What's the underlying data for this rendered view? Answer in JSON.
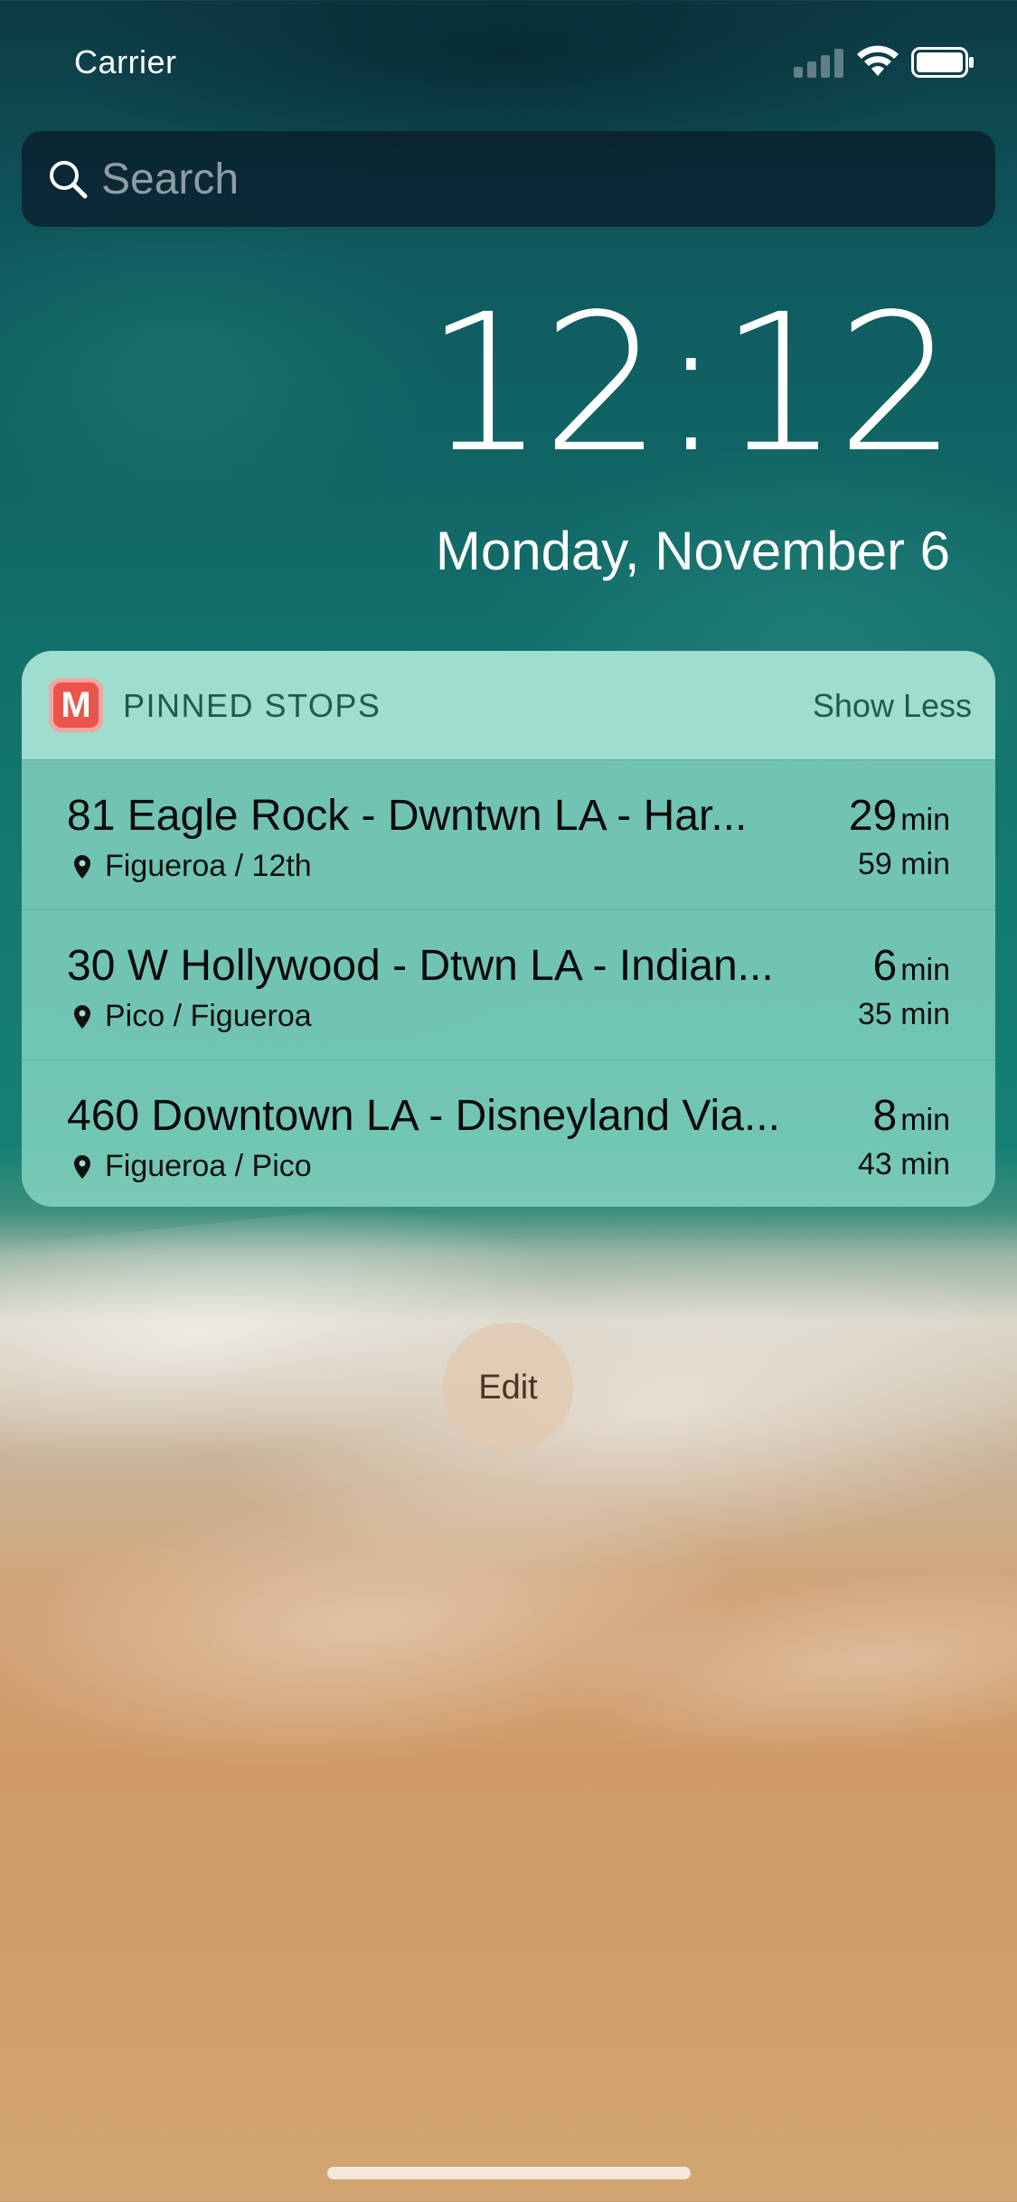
{
  "status_bar": {
    "carrier": "Carrier",
    "signal_icon": "cellular-signal-icon",
    "wifi_icon": "wifi-icon",
    "battery_icon": "battery-icon"
  },
  "search": {
    "placeholder": "Search",
    "icon": "search-icon"
  },
  "lock_screen": {
    "time": "12:12",
    "date": "Monday, November 6"
  },
  "widget": {
    "app_icon_letter": "M",
    "app_icon_color": "#e9554c",
    "title": "PINNED STOPS",
    "toggle_label": "Show Less",
    "rows": [
      {
        "route": "81 Eagle Rock - Dwntwn LA - Har...",
        "stop": "Figueroa / 12th",
        "eta_primary": "29",
        "eta_primary_unit": "min",
        "eta_secondary": "59 min"
      },
      {
        "route": "30 W Hollywood - Dtwn LA - Indian...",
        "stop": "Pico / Figueroa",
        "eta_primary": "6",
        "eta_primary_unit": "min",
        "eta_secondary": "35 min"
      },
      {
        "route": "460 Downtown LA - Disneyland Via...",
        "stop": "Figueroa / Pico",
        "eta_primary": "8",
        "eta_primary_unit": "min",
        "eta_secondary": "43 min"
      }
    ]
  },
  "edit_button": {
    "label": "Edit"
  }
}
